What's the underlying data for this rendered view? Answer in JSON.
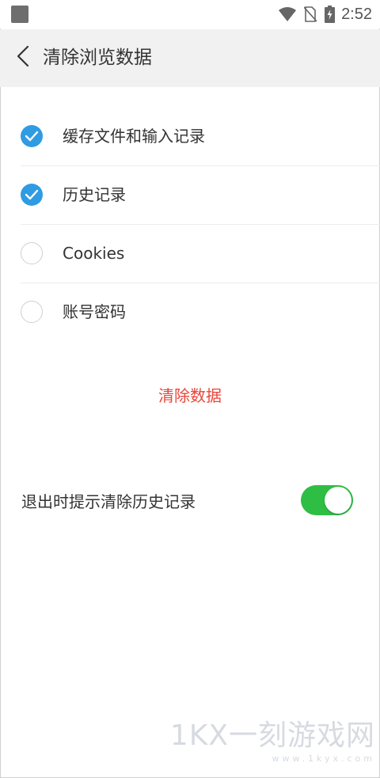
{
  "status_bar": {
    "time": "2:52",
    "icons": [
      "app-icon",
      "wifi-icon",
      "no-sim-icon",
      "battery-charging-icon"
    ]
  },
  "header": {
    "back_icon": "chevron-left-icon",
    "title": "清除浏览数据"
  },
  "options": [
    {
      "label": "缓存文件和输入记录",
      "checked": true
    },
    {
      "label": "历史记录",
      "checked": true
    },
    {
      "label": "Cookies",
      "checked": false
    },
    {
      "label": "账号密码",
      "checked": false
    }
  ],
  "clear_button": {
    "label": "清除数据",
    "color": "#e8473b"
  },
  "exit_prompt": {
    "label": "退出时提示清除历史记录",
    "enabled": true
  },
  "colors": {
    "accent": "#2f9be3",
    "toggle_on": "#2fbe44"
  },
  "watermark": {
    "main": "1KX一刻游戏网",
    "sub": "www.1kyx.com"
  }
}
